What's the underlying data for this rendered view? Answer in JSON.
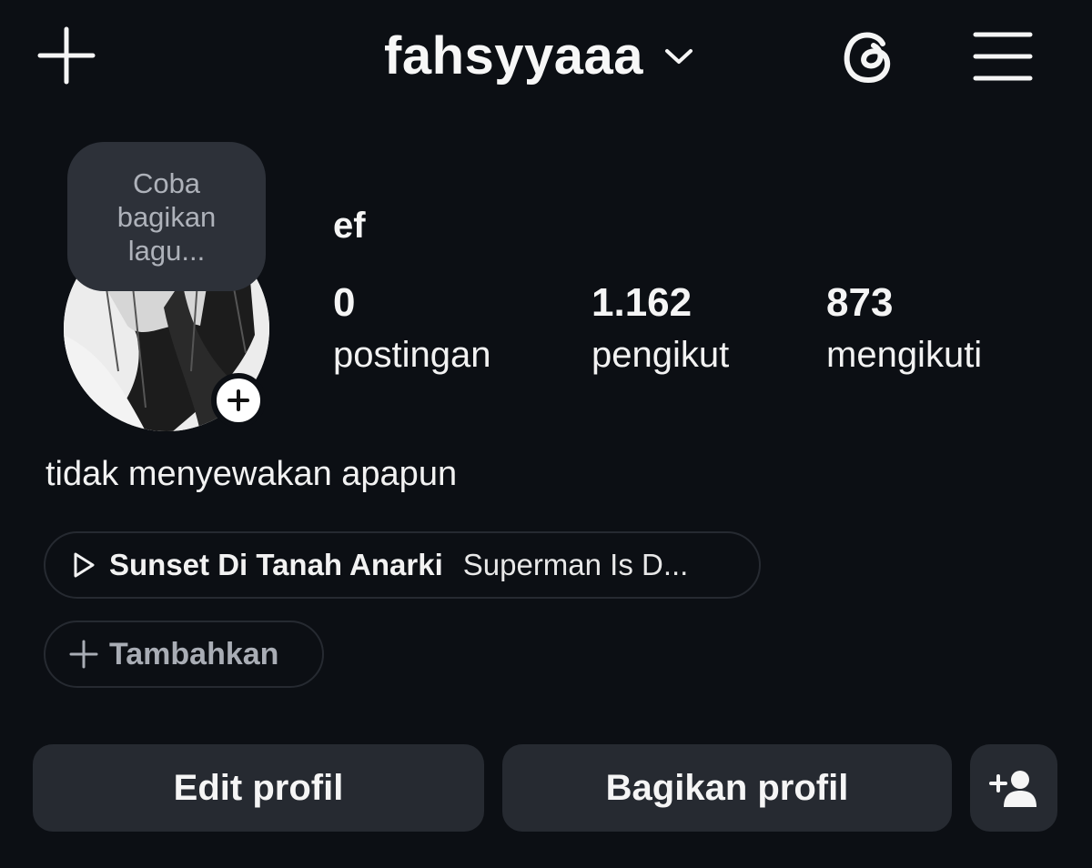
{
  "header": {
    "username": "fahsyyaaa",
    "icons": {
      "create": "plus-icon",
      "switch_account": "chevron-down-icon",
      "threads": "threads-icon",
      "menu": "menu-icon"
    }
  },
  "profile": {
    "note": "Coba bagikan lagu...",
    "display_name": "ef",
    "bio": "tidak menyewakan apapun"
  },
  "stats": [
    {
      "value": "0",
      "label": "postingan"
    },
    {
      "value": "1.162",
      "label": "pengikut"
    },
    {
      "value": "873",
      "label": "mengikuti"
    }
  ],
  "music": {
    "title": "Sunset Di Tanah Anarki",
    "artist": "Superman Is D..."
  },
  "add_link": {
    "label": "Tambahkan"
  },
  "buttons": {
    "edit": "Edit profil",
    "share": "Bagikan profil"
  },
  "colors": {
    "background": "#0c0f14",
    "button": "#262a31",
    "bubble": "#2d3139",
    "muted_text": "#a9adb5"
  }
}
